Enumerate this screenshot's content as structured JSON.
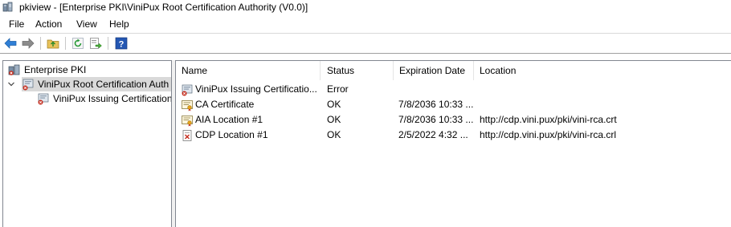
{
  "window": {
    "title": "pkiview - [Enterprise PKI\\ViniPux Root Certification Authority (V0.0)]",
    "app_icon": "pkiview-icon"
  },
  "menu": {
    "file": "File",
    "action": "Action",
    "view": "View",
    "help": "Help"
  },
  "toolbar": {
    "buttons": [
      "back-arrow-icon",
      "forward-arrow-icon",
      "up-folder-icon",
      "refresh-icon",
      "export-list-icon",
      "help-icon"
    ]
  },
  "tree": {
    "root": "Enterprise PKI",
    "ca": "ViniPux Root Certification Auth",
    "sub": "ViniPux Issuing Certification"
  },
  "list": {
    "headers": {
      "name": "Name",
      "status": "Status",
      "expiration": "Expiration Date",
      "location": "Location"
    },
    "rows": [
      {
        "name": "ViniPux Issuing Certificatio...",
        "status": "Error",
        "expiration": "",
        "location": "",
        "icon": "ca-error-icon"
      },
      {
        "name": "CA Certificate",
        "status": "OK",
        "expiration": "7/8/2036 10:33 ...",
        "location": "",
        "icon": "certificate-icon"
      },
      {
        "name": "AIA Location #1",
        "status": "OK",
        "expiration": "7/8/2036 10:33 ...",
        "location": "http://cdp.vini.pux/pki/vini-rca.crt",
        "icon": "certificate-icon"
      },
      {
        "name": "CDP Location #1",
        "status": "OK",
        "expiration": "2/5/2022 4:32 ...",
        "location": "http://cdp.vini.pux/pki/vini-rca.crl",
        "icon": "crl-icon"
      }
    ]
  },
  "colors": {
    "error_badge": "#c42b1c",
    "selected_bg": "#d9d9d9",
    "pane_border": "#828790"
  }
}
